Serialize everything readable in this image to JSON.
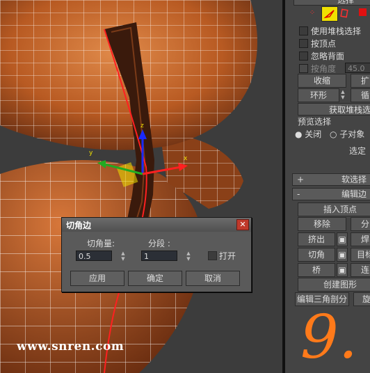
{
  "watermark": "www.snren.com",
  "panel": {
    "selection_title": "选择",
    "use_stack_selection": "使用堆栈选择",
    "by_vertex": "按顶点",
    "ignore_backfacing": "忽略背面",
    "by_angle": "按角度",
    "angle_value": "45.0",
    "shrink": "收缩",
    "grow": "扩",
    "ring": "环形",
    "loop": "循",
    "get_stack_selection": "获取堆栈选择",
    "preview_selection": "预览选择",
    "preview_off": "关闭",
    "preview_subobject": "子对象",
    "selected": "选定",
    "soft_selection_header": "软选择",
    "edit_edges_header": "编辑边",
    "edit_buttons": {
      "insert_vertex": "插入顶点",
      "remove": "移除",
      "split": "分",
      "extrude": "挤出",
      "weld": "焊",
      "chamfer": "切角",
      "target_weld": "目标",
      "bridge": "桥",
      "connect": "连",
      "create_shape": "创建图形",
      "edit_tri": "编辑三角剖分",
      "turn": "旋"
    },
    "expand_sign": "+",
    "collapse_sign": "-",
    "handwritten": "9."
  },
  "dialog": {
    "title": "切角边",
    "chamfer_amount_label": "切角量:",
    "chamfer_amount_value": "0.5",
    "segments_label": "分段 :",
    "segments_value": "1",
    "open_label": "打开",
    "apply": "应用",
    "ok": "确定",
    "cancel": "取消",
    "close_glyph": "✕"
  },
  "gizmo": {
    "x_label": "x",
    "y_label": "y",
    "z_label": "z"
  },
  "colors": {
    "mesh_orange": "#c7662b",
    "wire_white": "#ffffff",
    "selected_edge_red": "#ff2020",
    "accent_yellow": "#f0e000",
    "handwriting_orange": "#ff7a1a"
  }
}
